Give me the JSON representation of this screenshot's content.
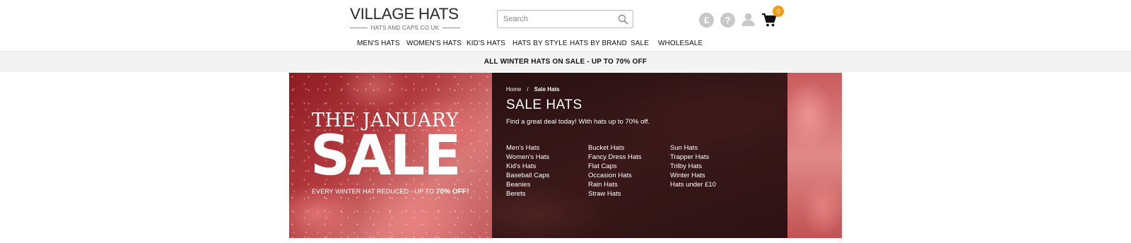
{
  "header": {
    "logo_title": "VILLAGE HATS",
    "logo_subtitle": "HATS AND CAPS.CO.UK",
    "search_placeholder": "Search",
    "currency_symbol": "£",
    "help_symbol": "?",
    "cart_count": "0",
    "accent_color": "#f39c12"
  },
  "nav": {
    "items": [
      "MEN'S HATS",
      "WOMEN'S HATS",
      "KID'S HATS",
      "HATS BY STYLE",
      "HATS BY BRAND",
      "SALE",
      "WHOLESALE"
    ]
  },
  "promo": {
    "text": "ALL WINTER HATS ON SALE - UP TO 70% OFF"
  },
  "banner": {
    "title_line": "THE JANUARY",
    "big_word": "SALE",
    "subline_prefix": "EVERY WINTER HAT REDUCED - UP TO ",
    "subline_highlight": "70% OFF!",
    "breadcrumb": {
      "home": "Home",
      "separator": "/",
      "current": "Sale Hats"
    },
    "heading": "SALE HATS",
    "description": "Find a great deal today! With hats up to 70% off.",
    "categories": [
      [
        "Men's Hats",
        "Women's Hats",
        "Kid's Hats",
        "Baseball Caps",
        "Beanies",
        "Berets"
      ],
      [
        "Bucket Hats",
        "Fancy Dress Hats",
        "Flat Caps",
        "Occasion Hats",
        "Rain Hats",
        "Straw Hats"
      ],
      [
        "Sun Hats",
        "Trapper Hats",
        "Trilby Hats",
        "Winter Hats",
        "Hats under £10"
      ]
    ]
  }
}
